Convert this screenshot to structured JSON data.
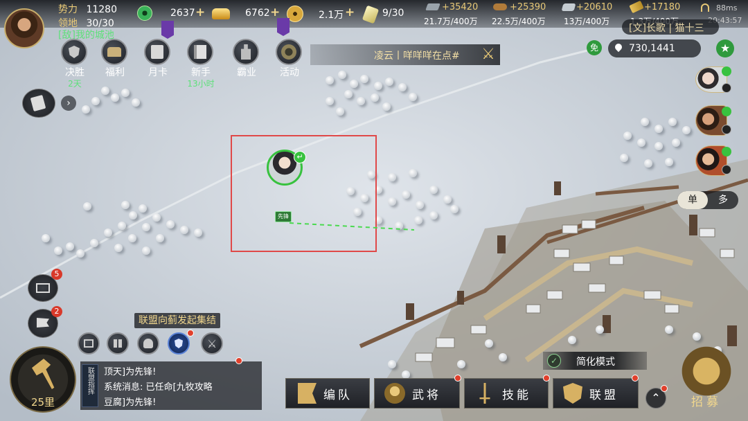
{
  "top_bar": {
    "power_label": "势力",
    "power_value": "11280",
    "territory_label": "领地",
    "territory_value": "30/30",
    "jade_value": "2637",
    "gold_value": "6762",
    "coin_value": "2.1万",
    "token_value": "9/30",
    "city_link": "[敌]我的城池",
    "plus_symbol": "+"
  },
  "resources": [
    {
      "name": "iron-icon",
      "gain": "+35420",
      "amount": "21.7万/400万"
    },
    {
      "name": "wood-icon",
      "gain": "+25390",
      "amount": "22.5万/400万"
    },
    {
      "name": "stone-icon",
      "gain": "+20610",
      "amount": "13万/400万"
    },
    {
      "name": "grain-icon",
      "gain": "+17180",
      "amount": "1.3万/400万"
    }
  ],
  "status": {
    "ping": "88ms",
    "time": "20:43:57"
  },
  "alliance_chat_top": "[文]长歌 | 猫十三",
  "menu_items": [
    {
      "label": "决胜",
      "sub": "2天",
      "icon": "shield-icon"
    },
    {
      "label": "福利",
      "sub": "",
      "icon": "chest-icon"
    },
    {
      "label": "月卡",
      "sub": "",
      "icon": "card-icon"
    },
    {
      "label": "新手",
      "sub": "13小时",
      "icon": "book-icon"
    },
    {
      "label": "霸业",
      "sub": "",
      "icon": "tower-icon"
    },
    {
      "label": "活动",
      "sub": "",
      "icon": "event-icon"
    }
  ],
  "marquee": "凌云丨咩咩咩在点#",
  "free_label": "免",
  "coordinates": "730,1441",
  "mode_toggle": {
    "single": "单",
    "multi": "多"
  },
  "march_tag": "先锋",
  "mail_badge": "5",
  "battle_badge": "2",
  "rally_notice": "联盟向蓟发起集结",
  "distance": "25里",
  "chat_side_label": "联盟指挥",
  "chat_lines": [
    "顶天]为先锋!",
    "系统消息: 已任命[九牧攻略",
    "豆腐]为先锋!"
  ],
  "simplified_mode": "简化模式",
  "bottom_buttons": [
    {
      "label": "编队",
      "icon": "banner-icon"
    },
    {
      "label": "武将",
      "icon": "general-icon"
    },
    {
      "label": "技能",
      "icon": "sword-icon"
    },
    {
      "label": "联盟",
      "icon": "alliance-icon"
    }
  ],
  "recruit_label": "招募",
  "colors": {
    "accent_gold": "#e8c977",
    "highlight_red": "#e04848",
    "march_green": "#38c23f"
  }
}
